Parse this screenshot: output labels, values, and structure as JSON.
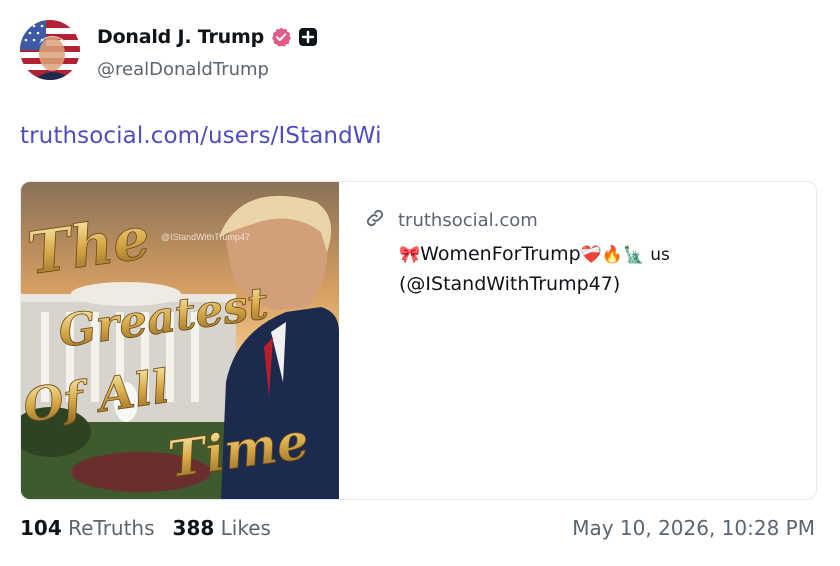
{
  "author": {
    "display_name": "Donald J. Trump",
    "handle": "@realDonaldTrump",
    "avatar_icon": "flag-portrait-avatar"
  },
  "post": {
    "link_text": "truthsocial.com/users/IStandWi"
  },
  "link_card": {
    "domain": "truthsocial.com",
    "title_prefix_emoji": "🎀",
    "title_name": "WomenForTrump",
    "title_emojis": "❤️‍🩹🔥🗽",
    "title_suffix": "us",
    "title_handle": "(@IStandWithTrump47)",
    "image_text_lines": [
      "The",
      "Greatest",
      "Of All",
      "Time"
    ],
    "image_watermark": "@IStandWithTrump47"
  },
  "stats": {
    "retruths_count": "104",
    "retruths_label": "ReTruths",
    "likes_count": "388",
    "likes_label": "Likes"
  },
  "timestamp": "May 10, 2026, 10:28 PM",
  "colors": {
    "link": "#4e4dbd",
    "muted": "#5b6570",
    "verified_badge": "#e05a8a"
  }
}
